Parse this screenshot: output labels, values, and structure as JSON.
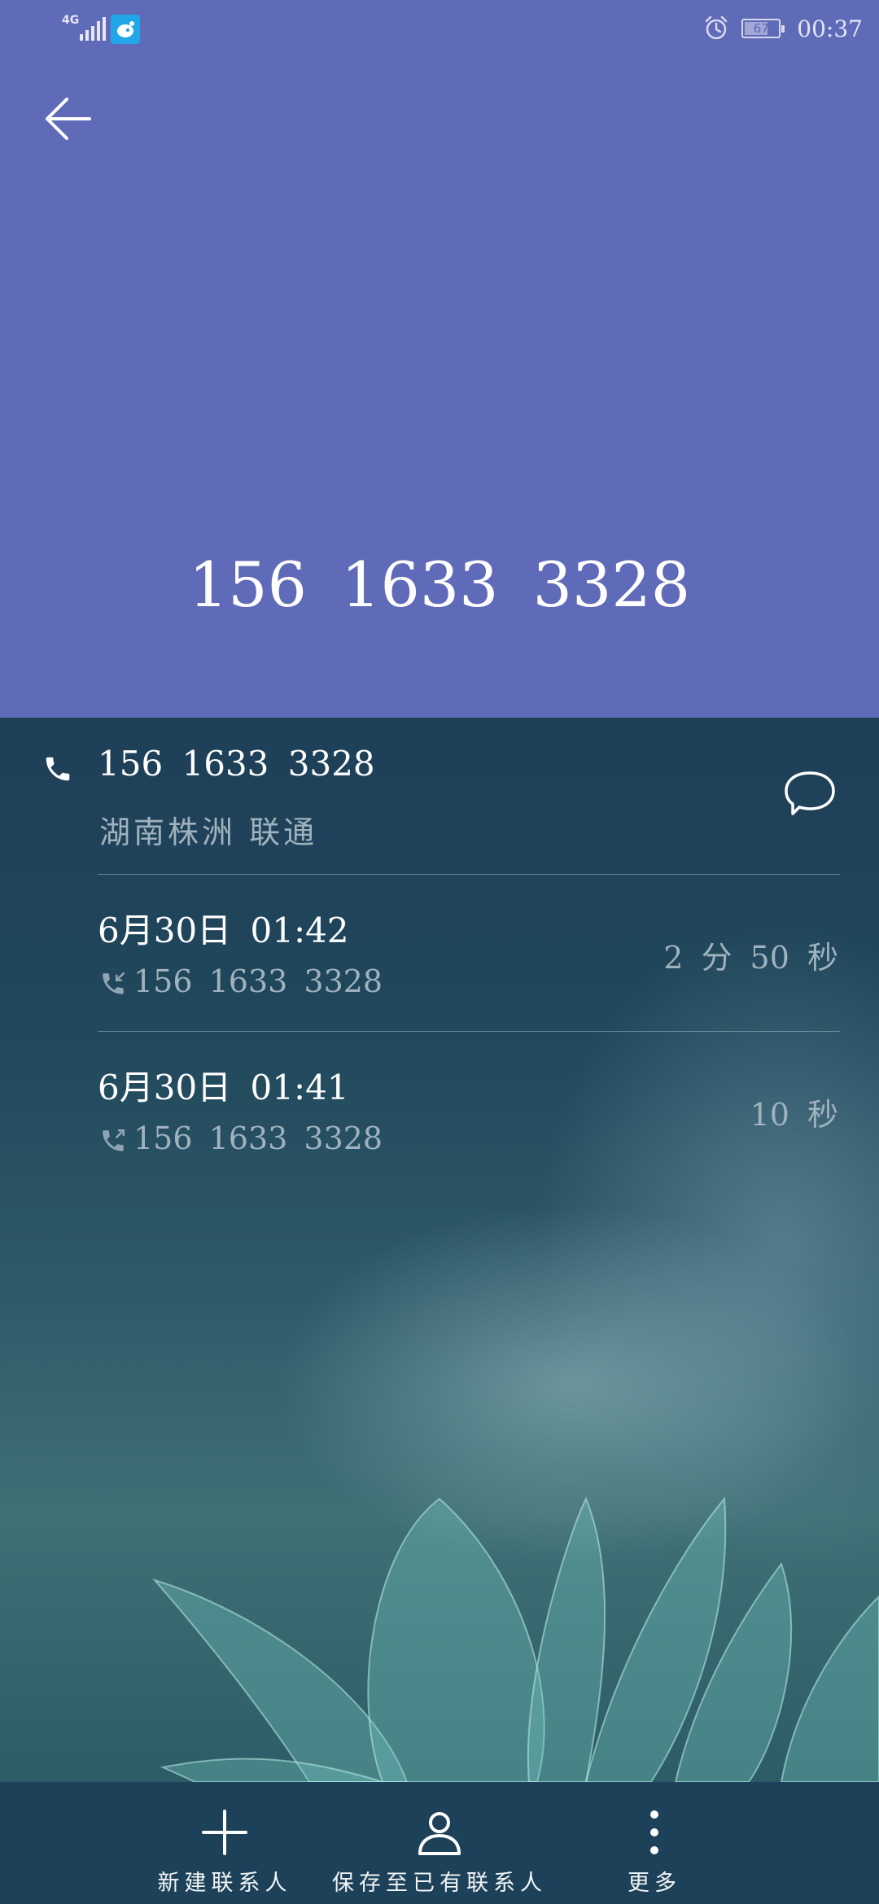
{
  "status_bar": {
    "network": "4G",
    "battery_level": "67",
    "time": "00:37"
  },
  "header": {
    "phone_number": "156  1633  3328"
  },
  "contact": {
    "number": "156  1633  3328",
    "location": "湖南株洲 联通"
  },
  "calls": [
    {
      "datetime": "6月30日  01:42",
      "number": "156  1633  3328",
      "duration": "2 分 50 秒",
      "type": "incoming"
    },
    {
      "datetime": "6月30日  01:41",
      "number": "156  1633  3328",
      "duration": "10 秒",
      "type": "outgoing"
    }
  ],
  "bottom_bar": {
    "new_contact": "新建联系人",
    "save_existing": "保存至已有联系人",
    "more": "更多"
  },
  "colors": {
    "header_bg": "#5f6bb8",
    "body_bg": "#1e4258"
  }
}
